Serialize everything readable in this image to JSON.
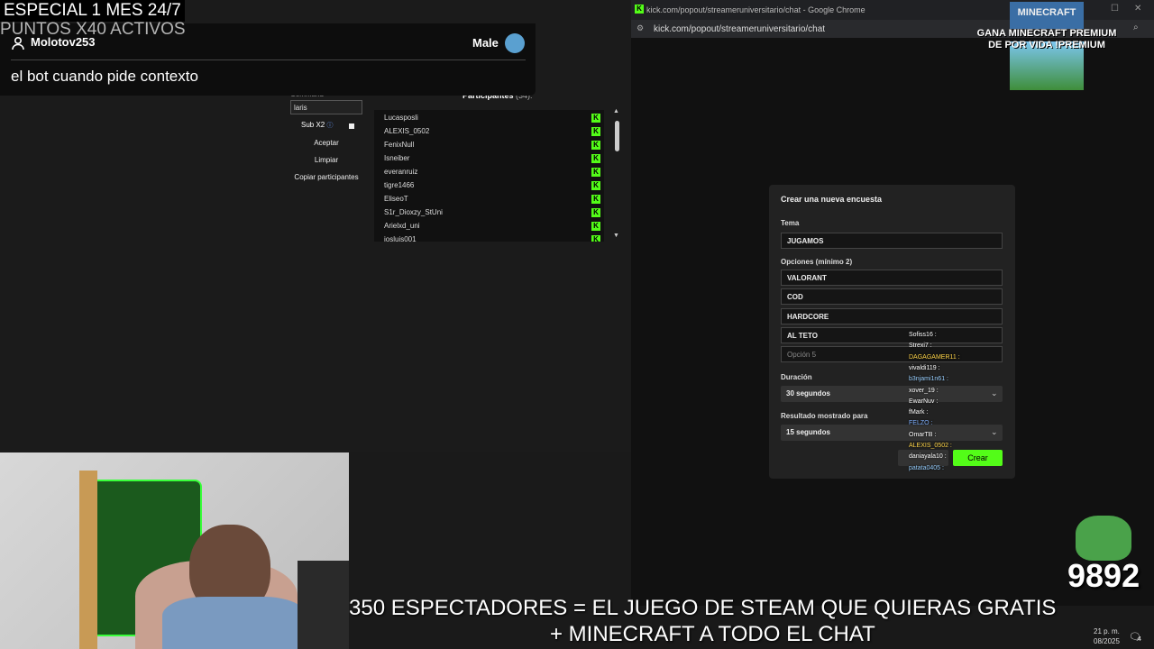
{
  "overlay": {
    "promo_line1": "ESPECIAL 1 MES 24/7",
    "promo_line2": "PUNTOS X40 ACTIVOS",
    "tts_user": "Molotov253",
    "tts_voice": "Male",
    "tts_message": "el bot cuando pide contexto"
  },
  "command_panel": {
    "label": "Command",
    "input_value": "laris",
    "subx2_label": "Sub X2",
    "accept": "Aceptar",
    "clear": "Limpiar",
    "copy": "Copiar participantes",
    "participants_title": "Participantes",
    "participants_count": "(34):",
    "participants": [
      "Lucasposli",
      "ALEXIS_0502",
      "FenixNull",
      "Isneiber",
      "everanruiz",
      "tigre1466",
      "EliseoT",
      "S1r_Dioxzy_StUni",
      "Arielxd_uni",
      "josluis001"
    ]
  },
  "chrome": {
    "title": "kick.com/popout/streameruniversitario/chat - Google Chrome",
    "url": "kick.com/popout/streameruniversitario/chat"
  },
  "poll_modal": {
    "title": "Crear una nueva encuesta",
    "topic_label": "Tema",
    "topic_value": "JUGAMOS",
    "options_label": "Opciones (mínimo 2)",
    "options": [
      "VALORANT",
      "COD",
      "HARDCORE",
      "AL TETO"
    ],
    "option5_placeholder": "Opción 5",
    "duration_label": "Duración",
    "duration_value": "30 segundos",
    "result_label": "Resultado mostrado para",
    "result_value": "15 segundos",
    "create": "Crear"
  },
  "chat_overlay": [
    {
      "user": "Sofiss16",
      "color": "#ffffff"
    },
    {
      "user": "Strexi7",
      "color": "#ffffff"
    },
    {
      "user": "DAGAGAMER11",
      "color": "#ffd54a"
    },
    {
      "user": "vivaldi119",
      "color": "#ffffff"
    },
    {
      "user": "b3njami1n61",
      "color": "#9ad0ff"
    },
    {
      "user": "xover_19",
      "color": "#ffffff"
    },
    {
      "user": "EwarNuv",
      "color": "#ffffff"
    },
    {
      "user": "fMark",
      "color": "#ffffff"
    },
    {
      "user": "FELZO",
      "color": "#7fb0ff"
    },
    {
      "user": "OmarTB",
      "color": "#ffffff"
    },
    {
      "user": "ALEXIS_0502",
      "color": "#ffd54a"
    },
    {
      "user": "daniayala10",
      "color": "#ffffff"
    },
    {
      "user": "patata0405",
      "color": "#9ad0ff"
    }
  ],
  "minecraft_badge": {
    "logo": "MINECRAFT",
    "promo": "GANA MINECRAFT PREMIUM DE POR VIDA !PREMIUM"
  },
  "bottom": {
    "line1": "350 ESPECTADORES = EL JUEGO DE STEAM QUE QUIERAS GRATIS",
    "line2": "+ MINECRAFT A TODO EL CHAT",
    "counter": "9892",
    "time": "21 p. m.",
    "date": "08/2025",
    "notif_count": "4"
  }
}
